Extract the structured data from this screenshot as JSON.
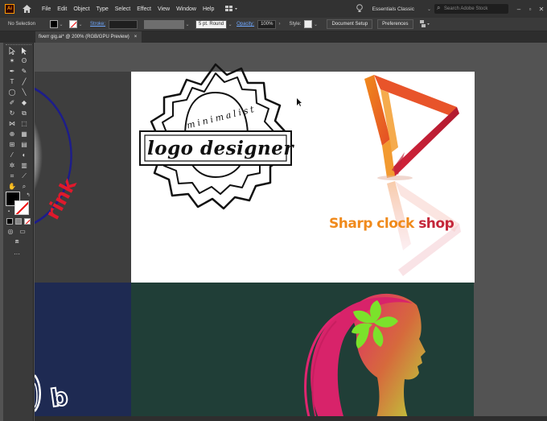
{
  "menubar": {
    "app_logo": "Ai",
    "menu_items": [
      "File",
      "Edit",
      "Object",
      "Type",
      "Select",
      "Effect",
      "View",
      "Window",
      "Help"
    ],
    "workspace": "Essentials Classic",
    "search_placeholder": "Search Adobe Stock",
    "icons": [
      "home-icon",
      "arrange-documents-icon",
      "bulb-icon",
      "search-icon"
    ]
  },
  "controlbar": {
    "selection_label": "No Selection",
    "stroke_label": "Stroke:",
    "brush_value": "5 pt. Round",
    "opacity_label": "Opacity:",
    "opacity_value": "100%",
    "style_label": "Style:",
    "document_setup": "Document Setup",
    "preferences": "Preferences"
  },
  "document": {
    "tab_title": "fiverr gig.ai* @ 200% (RGB/GPU Preview)",
    "close_symbol": "×"
  },
  "artwork": {
    "badge_top_text": "minimalist",
    "badge_main_text": "logo designer",
    "shop_text_part1": "Sharp clock ",
    "shop_text_part2": "shop",
    "drink_text": "rink",
    "partial_letter": "b",
    "colors": {
      "orange": "#f08a1c",
      "red": "#c4273a",
      "navy": "#1e2a52",
      "green_bg": "#203e37",
      "leaf_green": "#7be22b",
      "magenta": "#e0256f"
    }
  }
}
